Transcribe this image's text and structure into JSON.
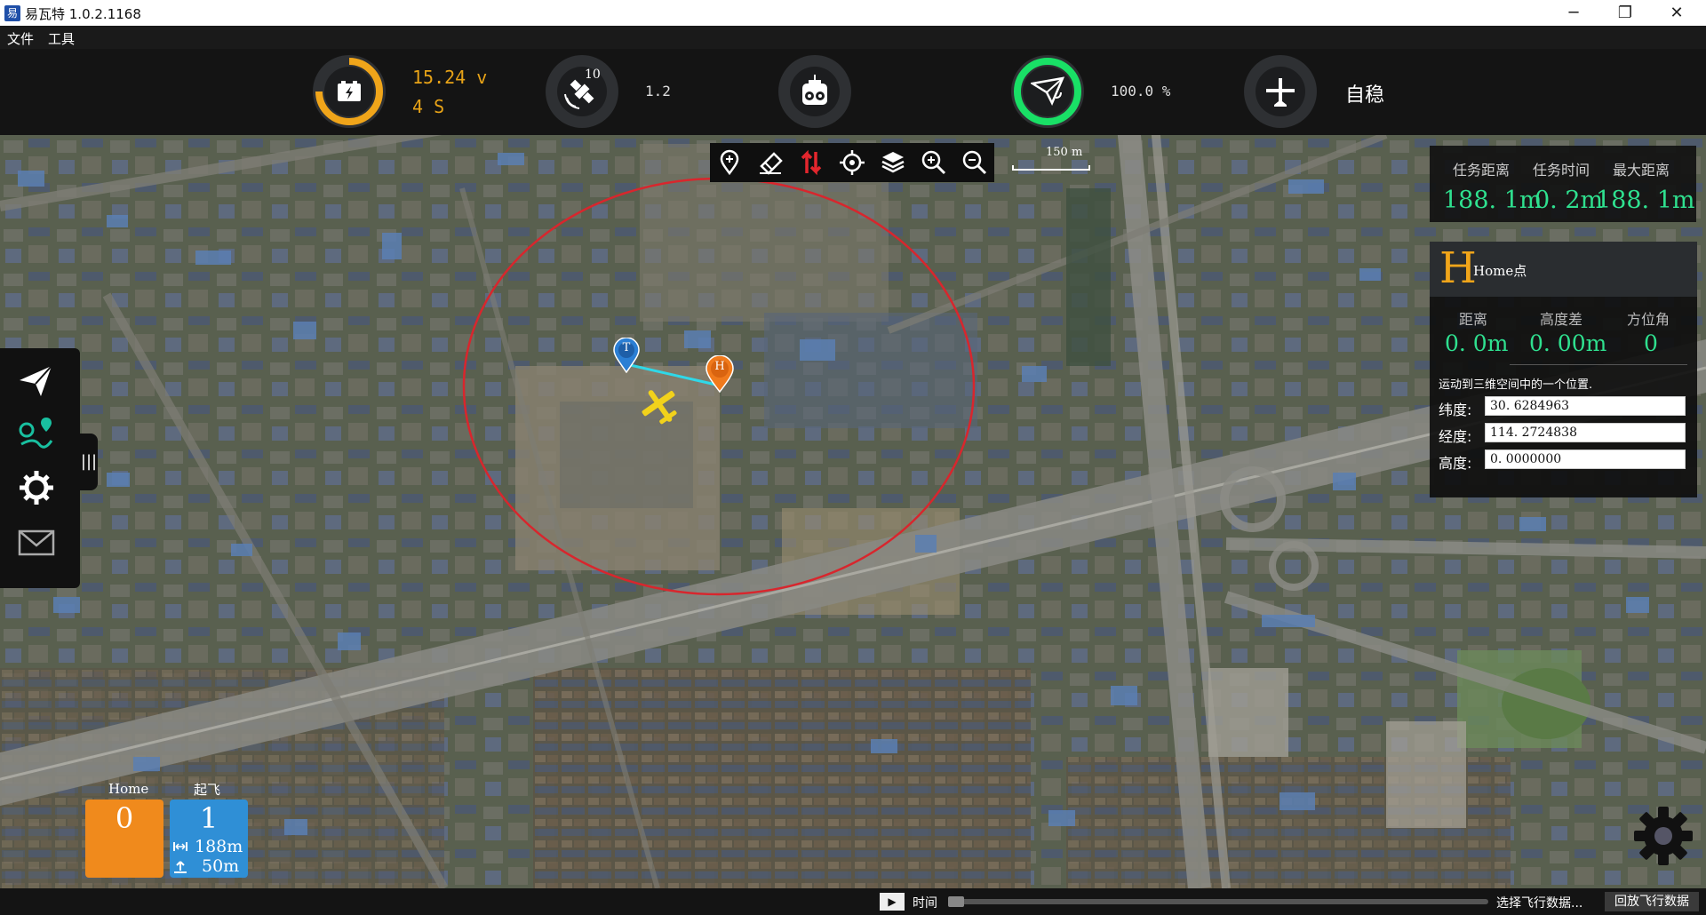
{
  "window": {
    "title": "易瓦特 1.0.2.1168",
    "controls": {
      "minimize": "─",
      "restore": "❐",
      "close": "✕"
    }
  },
  "menu": {
    "items": [
      "文件",
      "工具"
    ]
  },
  "telemetry": {
    "battery": {
      "voltage": "15.24 v",
      "cells": "4 S",
      "level_percent": 75,
      "color": "#f0a51a",
      "icon": "battery-bolt-icon"
    },
    "gps": {
      "satellites": "10",
      "hdop": "1.2",
      "icon": "satellite-icon"
    },
    "remote": {
      "icon": "remote-controller-icon"
    },
    "signal": {
      "percent_text": "100.0 %",
      "level_percent": 100,
      "color": "#19e066",
      "icon": "paper-plane-signal-icon"
    },
    "mode": {
      "label": "自稳",
      "icon": "airplane-icon"
    }
  },
  "map_toolbar": {
    "tools": [
      {
        "name": "waypoint-add",
        "glyph": "⊕"
      },
      {
        "name": "eraser",
        "glyph": "✎"
      },
      {
        "name": "reverse-route",
        "glyph": "⇅"
      },
      {
        "name": "locate",
        "glyph": "⌖"
      },
      {
        "name": "layers",
        "glyph": "≋"
      },
      {
        "name": "zoom-in",
        "glyph": "⊕"
      },
      {
        "name": "zoom-out",
        "glyph": "⊖"
      }
    ]
  },
  "scale_bar": {
    "label": "150 m"
  },
  "mission": {
    "headers": [
      "任务距离",
      "任务时间",
      "最大距离"
    ],
    "values": [
      "188. 1m",
      "0. 2m",
      "188. 1m"
    ]
  },
  "home_panel": {
    "big_letter": "H",
    "title": "Home点",
    "headers": [
      "距离",
      "高度差",
      "方位角"
    ],
    "values": [
      "0. 0m",
      "0. 00m",
      "0"
    ],
    "description": "运动到三维空间中的一个位置.",
    "fields": [
      {
        "label": "纬度:",
        "value": "30. 6284963"
      },
      {
        "label": "经度:",
        "value": "114. 2724838"
      },
      {
        "label": "高度:",
        "value": "0. 0000000"
      }
    ]
  },
  "map_markers": {
    "takeoff": "T",
    "home": "H",
    "aircraft_color": "#f2d21b",
    "geofence_color": "#d8262d",
    "route_color": "#2fd8e8"
  },
  "sidebar": {
    "icons": [
      "paper-plane-icon",
      "route-map-icon",
      "gear-icon",
      "envelope-icon"
    ],
    "handle": "|||"
  },
  "waypoints": {
    "home_label": "Home",
    "home_index": "0",
    "home_color": "#f08a1c",
    "takeoff_label": "起飞",
    "takeoff_index": "1",
    "takeoff_color": "#2f8fd6",
    "distance": "188m",
    "altitude": "50m"
  },
  "statusbar": {
    "play": "▶",
    "time_label": "时间",
    "choose_label": "选择飞行数据...",
    "replay_label": "回放飞行数据"
  }
}
